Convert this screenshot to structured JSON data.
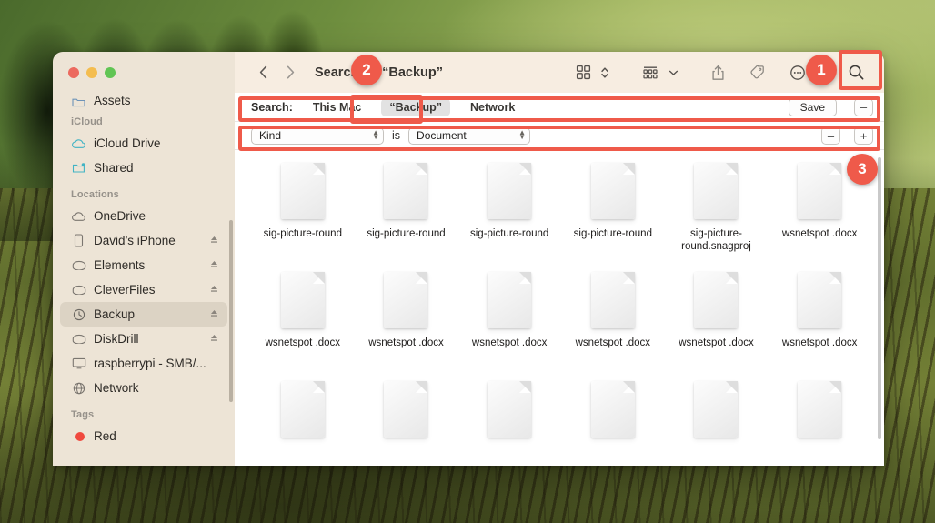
{
  "window": {
    "title": "Searching “Backup”",
    "traffic_lights": [
      "close",
      "minimize",
      "zoom"
    ]
  },
  "toolbar": {
    "back_icon": "chevron-left-icon",
    "forward_icon": "chevron-right-icon",
    "view_icon": "grid-view-icon",
    "view_sort_icon": "chevron-updown-icon",
    "group_icon": "group-by-icon",
    "group_chevron_icon": "chevron-down-icon",
    "share_icon": "share-icon",
    "tag_icon": "tag-icon",
    "more_icon": "more-ellipsis-icon",
    "more_chevron_icon": "chevron-down-icon",
    "search_icon": "search-icon"
  },
  "search_scope": {
    "label": "Search:",
    "options": [
      "This Mac",
      "“Backup”",
      "Network"
    ],
    "active_option": "“Backup”",
    "save_label": "Save",
    "remove_label": "–"
  },
  "criteria": {
    "attribute": "Kind",
    "operator": "is",
    "value": "Document",
    "remove_label": "–",
    "add_label": "+"
  },
  "sidebar": {
    "clipped_top_item": {
      "label": "Assets",
      "icon": "folder-icon"
    },
    "groups": [
      {
        "label": "iCloud",
        "items": [
          {
            "label": "iCloud Drive",
            "icon": "cloud-icon",
            "eject": false,
            "selected": false
          },
          {
            "label": "Shared",
            "icon": "shared-folder-icon",
            "eject": false,
            "selected": false
          }
        ]
      },
      {
        "label": "Locations",
        "items": [
          {
            "label": "OneDrive",
            "icon": "cloud-icon",
            "eject": false,
            "selected": false
          },
          {
            "label": "David’s iPhone",
            "icon": "iphone-icon",
            "eject": true,
            "selected": false
          },
          {
            "label": "Elements",
            "icon": "external-drive-icon",
            "eject": true,
            "selected": false
          },
          {
            "label": "CleverFiles",
            "icon": "external-drive-icon",
            "eject": true,
            "selected": false
          },
          {
            "label": "Backup",
            "icon": "time-machine-icon",
            "eject": true,
            "selected": true
          },
          {
            "label": "DiskDrill",
            "icon": "external-drive-icon",
            "eject": true,
            "selected": false
          },
          {
            "label": "raspberrypi - SMB/...",
            "icon": "display-icon",
            "eject": false,
            "selected": false
          },
          {
            "label": "Network",
            "icon": "globe-icon",
            "eject": false,
            "selected": false
          }
        ]
      },
      {
        "label": "Tags",
        "items": [
          {
            "label": "Red",
            "icon": "red-tag-dot-icon",
            "eject": false,
            "selected": false
          }
        ]
      }
    ]
  },
  "files": {
    "rows": [
      [
        {
          "name": "sig-picture-round",
          "icon": "document-icon"
        },
        {
          "name": "sig-picture-round",
          "icon": "document-icon"
        },
        {
          "name": "sig-picture-round",
          "icon": "document-icon"
        },
        {
          "name": "sig-picture-round",
          "icon": "document-icon"
        },
        {
          "name": "sig-picture-round.snagproj",
          "icon": "document-icon"
        },
        {
          "name": "wsnetspot .docx",
          "icon": "document-icon"
        }
      ],
      [
        {
          "name": "wsnetspot .docx",
          "icon": "document-icon"
        },
        {
          "name": "wsnetspot .docx",
          "icon": "document-icon"
        },
        {
          "name": "wsnetspot .docx",
          "icon": "document-icon"
        },
        {
          "name": "wsnetspot .docx",
          "icon": "document-icon"
        },
        {
          "name": "wsnetspot .docx",
          "icon": "document-icon"
        },
        {
          "name": "wsnetspot .docx",
          "icon": "document-icon"
        }
      ],
      [
        {
          "name": "",
          "icon": "document-icon"
        },
        {
          "name": "",
          "icon": "document-icon"
        },
        {
          "name": "",
          "icon": "document-icon"
        },
        {
          "name": "",
          "icon": "document-icon"
        },
        {
          "name": "",
          "icon": "document-icon"
        },
        {
          "name": "",
          "icon": "document-icon"
        }
      ]
    ]
  },
  "annotations": {
    "accent_color": "#ef5a4a",
    "badges": [
      {
        "number": "1",
        "target": "search-toolbar-button"
      },
      {
        "number": "2",
        "target": "search-scope-backup"
      },
      {
        "number": "3",
        "target": "criteria-row"
      }
    ],
    "boxes": [
      {
        "target": "search-toolbar-button"
      },
      {
        "target": "search-scope-backup"
      },
      {
        "target": "search-scope-bar"
      },
      {
        "target": "criteria-row"
      }
    ]
  }
}
